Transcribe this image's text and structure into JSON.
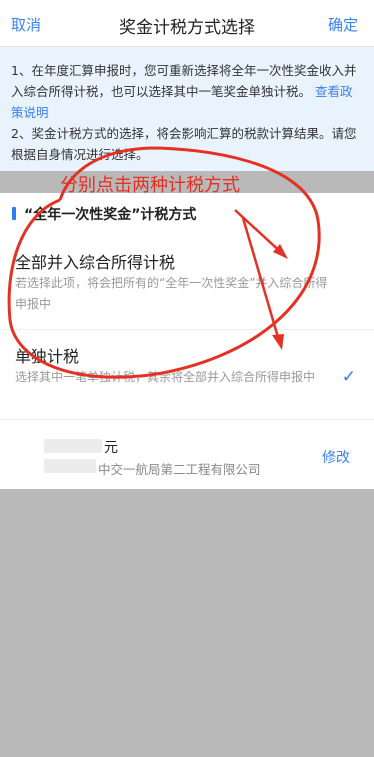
{
  "header": {
    "cancel_label": "取消",
    "title": "奖金计税方式选择",
    "confirm_label": "确定"
  },
  "notice": {
    "line1": "1、在年度汇算申报时，您可重新选择将全年一次性奖金收入并入综合所得计税，也可以选择其中一笔奖金单独计税。",
    "policy_link": "查看政策说明",
    "line2": "2、奖金计税方式的选择，将会影响汇算的税款计算结果。请您根据自身情况进行选择。"
  },
  "section": {
    "title": "“全年一次性奖金”计税方式"
  },
  "options": [
    {
      "name": "全部并入综合所得计税",
      "desc": "若选择此项，将会把所有的“全年一次性奖金”并入综合所得申报中",
      "selected": false
    },
    {
      "name": "单独计税",
      "desc": "选择其中一笔单独计税，其余将全部并入综合所得申报中",
      "selected": true
    }
  ],
  "bonus": {
    "amount_suffix": "元",
    "company": "中交一航局第二工程有限公司",
    "modify_label": "修改"
  },
  "annotation": {
    "text": "分别点击两种计税方式",
    "color": "#e53124"
  }
}
